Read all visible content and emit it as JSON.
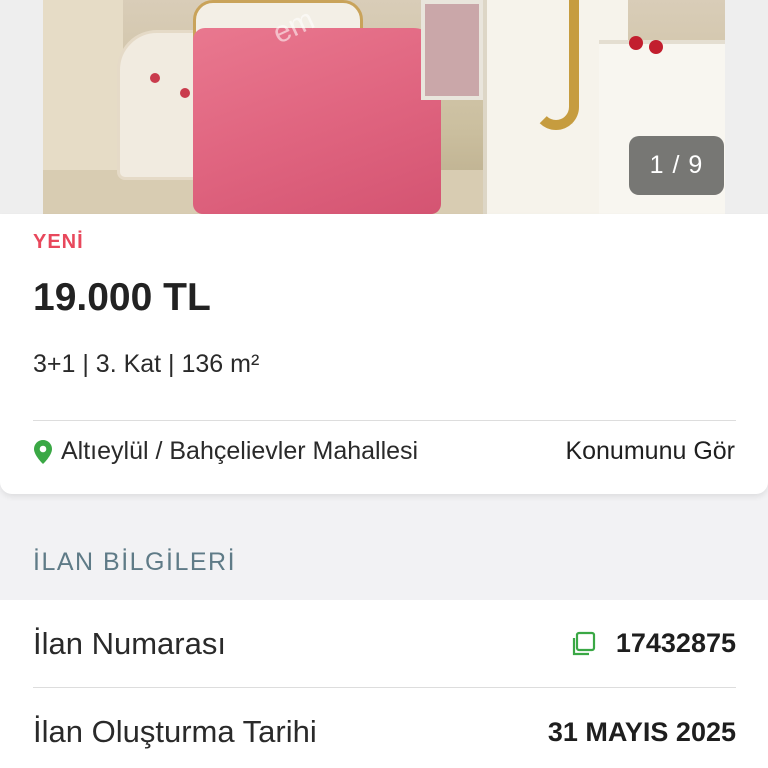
{
  "gallery": {
    "counter": "1 / 9",
    "watermark": "em"
  },
  "listing": {
    "badge": "YENİ",
    "price": "19.000 TL",
    "specs": "3+1 | 3. Kat | 136 m²",
    "location": "Altıeylül / Bahçelievler Mahallesi",
    "location_link": "Konumunu Gör"
  },
  "info_section": {
    "title": "İLAN BİLGİLERİ",
    "rows": [
      {
        "label": "İlan Numarası",
        "value": "17432875"
      },
      {
        "label": "İlan Oluşturma Tarihi",
        "value": "31 MAYIS 2025"
      }
    ]
  },
  "colors": {
    "badge": "#e8485c",
    "location_pin": "#3aa845",
    "section_title": "#5f7b87",
    "copy_icon": "#3aa845"
  },
  "icons": {
    "location": "location-pin-icon",
    "copy": "copy-icon"
  }
}
